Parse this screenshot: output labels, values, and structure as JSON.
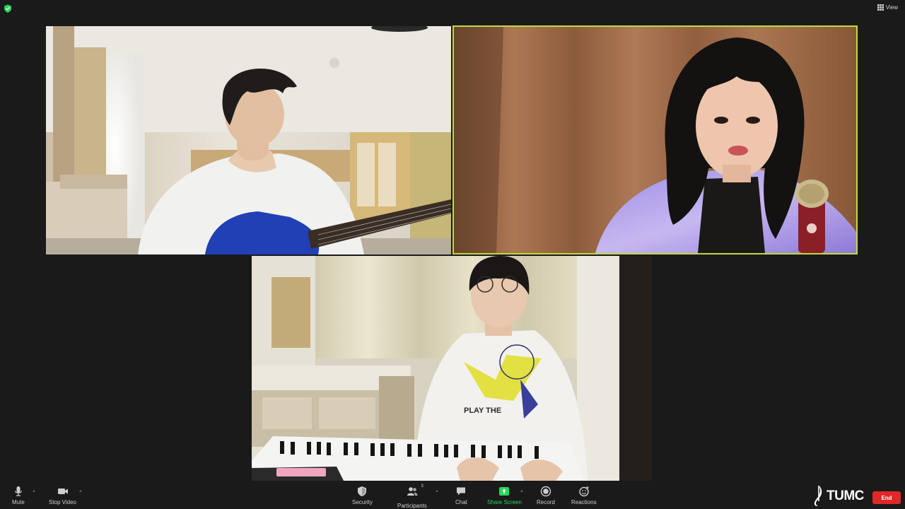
{
  "header": {
    "view_label": "View",
    "shield_color": "#2bd65a"
  },
  "tiles": {
    "active_speaker_border": "#c4d93a",
    "keys_shirt_text": "PLAY THE"
  },
  "toolbar": {
    "mute_label": "Mute",
    "stop_video_label": "Stop Video",
    "security_label": "Security",
    "participants_label": "Participants",
    "participants_count": "3",
    "chat_label": "Chat",
    "share_screen_label": "Share Screen",
    "record_label": "Record",
    "reactions_label": "Reactions",
    "share_color": "#2bd65a"
  },
  "branding": {
    "logo_text": "TUMC"
  },
  "end_button": {
    "label": "End",
    "color": "#e02828"
  }
}
